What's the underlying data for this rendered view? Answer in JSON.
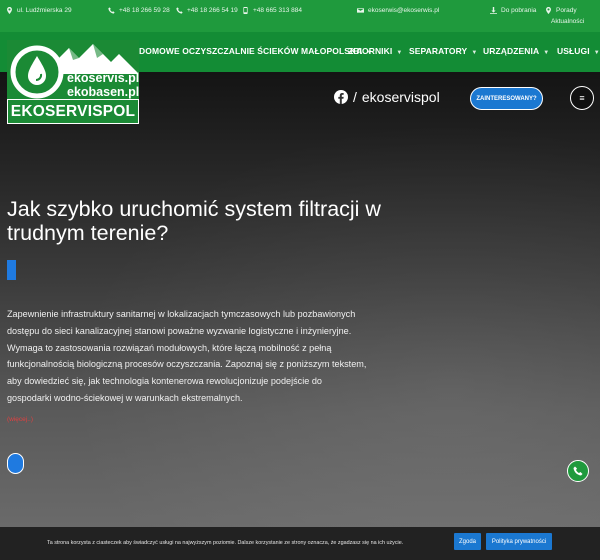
{
  "topbar": {
    "address": "ul. Ludźmierska 29",
    "phone1": "+48 18 266 59 28",
    "phone2": "+48 18 266 54 19",
    "mobile": "+48 665 313 884",
    "email": "ekoserwis@ekoserwis.pl",
    "downloads": "Do pobrania",
    "advice": "Porady",
    "news": "Aktualności"
  },
  "nav": {
    "items": [
      {
        "label": "DOMOWE OCZYSZCZALNIE ŚCIEKÓW MAŁOPOLSKA"
      },
      {
        "label": "ZBIORNIKI"
      },
      {
        "label": "SEPARATORY"
      },
      {
        "label": "URZĄDZENIA"
      },
      {
        "label": "USŁUGI"
      }
    ]
  },
  "logo": {
    "line1": "ekoservis.pl",
    "line2": "ekobasen.pl",
    "name": "EKOSERVISPOL"
  },
  "header": {
    "facebook_sep": "/",
    "facebook_handle": "ekoservispol",
    "cta_label": "ZAINTERESOWANY?",
    "menu_icon": "≡"
  },
  "hero": {
    "heading": "Jak szybko uruchomić system filtracji w trudnym terenie?",
    "body": "Zapewnienie infrastruktury sanitarnej w lokalizacjach tymczasowych lub pozbawionych dostępu do sieci kanalizacyjnej stanowi poważne wyzwanie logistyczne i inżynieryjne. Wymaga to zastosowania rozwiązań modułowych, które łączą mobilność z pełną funkcjonalnością biologiczną procesów oczyszczania. Zapoznaj się z poniższym tekstem, aby dowiedzieć się, jak technologia kontenerowa rewolucjonizuje podejście do gospodarki wodno-ściekowej w warunkach ekstremalnych.",
    "more_link": "(więcej..)"
  },
  "cookie": {
    "text": "Ta strona korzysta z ciasteczek aby świadczyć usługi na najwyższym poziomie. Dalsze korzystanie ze strony oznacza, że zgadzasz się na ich użycie.",
    "accept_label": "Zgoda",
    "policy_label": "Polityka prywatności"
  },
  "colors": {
    "topbar": "#1f9a3d",
    "navbar": "#138c35",
    "accent_blue": "#1b78d1",
    "link_red": "#e04040"
  }
}
